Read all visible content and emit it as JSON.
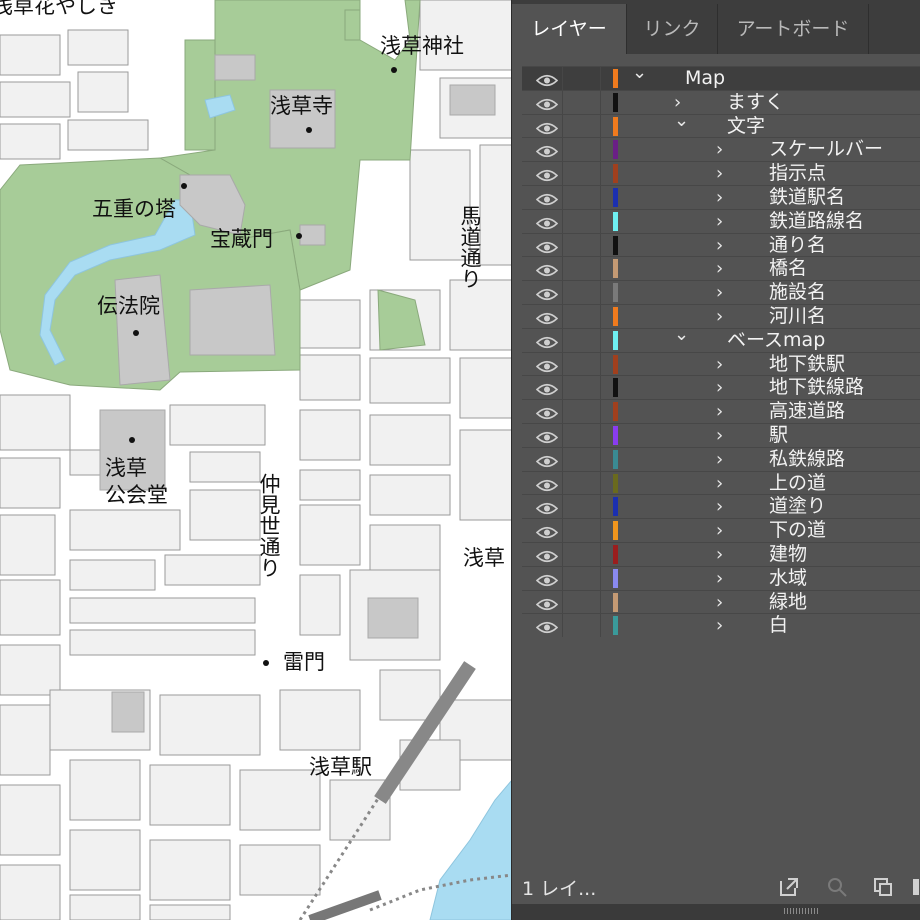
{
  "map": {
    "labels": [
      {
        "id": "top-left-partial",
        "text": "浅草花やしき"
      },
      {
        "id": "asakusa-shrine",
        "text": "浅草神社"
      },
      {
        "id": "sensoji",
        "text": "浅草寺"
      },
      {
        "id": "five-story-pagoda",
        "text": "五重の塔"
      },
      {
        "id": "hozomon",
        "text": "宝蔵門"
      },
      {
        "id": "umamichi-street",
        "text": "馬道通り"
      },
      {
        "id": "denboin",
        "text": "伝法院"
      },
      {
        "id": "public-hall",
        "text": "浅草\n公会堂"
      },
      {
        "id": "nakamise-street",
        "text": "仲見世通り"
      },
      {
        "id": "right-edge-partial",
        "text": "浅草"
      },
      {
        "id": "kaminarimon",
        "text": "雷門"
      },
      {
        "id": "asakusa-station",
        "text": "浅草駅"
      }
    ]
  },
  "panel": {
    "tabs": [
      {
        "label": "レイヤー",
        "active": true
      },
      {
        "label": "リンク",
        "active": false
      },
      {
        "label": "アートボード",
        "active": false
      }
    ],
    "layers": [
      {
        "name": "Map",
        "level": 0,
        "expanded": true,
        "color": "#f07b1e"
      },
      {
        "name": "ますく",
        "level": 1,
        "expanded": false,
        "color": "#111111"
      },
      {
        "name": "文字",
        "level": 1,
        "expanded": true,
        "color": "#f07b1e"
      },
      {
        "name": "スケールバー",
        "level": 2,
        "expanded": false,
        "color": "#6a1f86"
      },
      {
        "name": "指示点",
        "level": 2,
        "expanded": false,
        "color": "#a0401e"
      },
      {
        "name": "鉄道駅名",
        "level": 2,
        "expanded": false,
        "color": "#1b2fb0"
      },
      {
        "name": "鉄道路線名",
        "level": 2,
        "expanded": false,
        "color": "#6ff0f2"
      },
      {
        "name": "通り名",
        "level": 2,
        "expanded": false,
        "color": "#111111"
      },
      {
        "name": "橋名",
        "level": 2,
        "expanded": false,
        "color": "#c49a74"
      },
      {
        "name": "施設名",
        "level": 2,
        "expanded": false,
        "color": "#7a7a7a"
      },
      {
        "name": "河川名",
        "level": 2,
        "expanded": false,
        "color": "#f07b1e"
      },
      {
        "name": "ベースmap",
        "level": 1,
        "expanded": true,
        "color": "#6ff0f2"
      },
      {
        "name": "地下鉄駅",
        "level": 2,
        "expanded": false,
        "color": "#a0401e"
      },
      {
        "name": "地下鉄線路",
        "level": 2,
        "expanded": false,
        "color": "#111111"
      },
      {
        "name": "高速道路",
        "level": 2,
        "expanded": false,
        "color": "#a0401e"
      },
      {
        "name": "駅",
        "level": 2,
        "expanded": false,
        "color": "#8a3cf0"
      },
      {
        "name": "私鉄線路",
        "level": 2,
        "expanded": false,
        "color": "#3a8a92"
      },
      {
        "name": "上の道",
        "level": 2,
        "expanded": false,
        "color": "#6a6a1e"
      },
      {
        "name": "道塗り",
        "level": 2,
        "expanded": false,
        "color": "#1b2fb0"
      },
      {
        "name": "下の道",
        "level": 2,
        "expanded": false,
        "color": "#f0961e"
      },
      {
        "name": "建物",
        "level": 2,
        "expanded": false,
        "color": "#9a1e1e"
      },
      {
        "name": "水域",
        "level": 2,
        "expanded": false,
        "color": "#8a8af0"
      },
      {
        "name": "緑地",
        "level": 2,
        "expanded": false,
        "color": "#c49a74"
      },
      {
        "name": "白",
        "level": 2,
        "expanded": false,
        "color": "#3a9a9a"
      }
    ],
    "footer": {
      "count_text": "1 レイ...",
      "icons": [
        "export-icon",
        "search-icon",
        "collect-icon",
        "trash-icon"
      ]
    }
  },
  "colors": {
    "park": "#a7cc98",
    "water": "#a9dcf2",
    "building": "#c8c8c8",
    "block": "#f1f1f1",
    "road": "#ffffff",
    "panel_bg": "#535353",
    "tab_bar": "#3d3d3d"
  }
}
